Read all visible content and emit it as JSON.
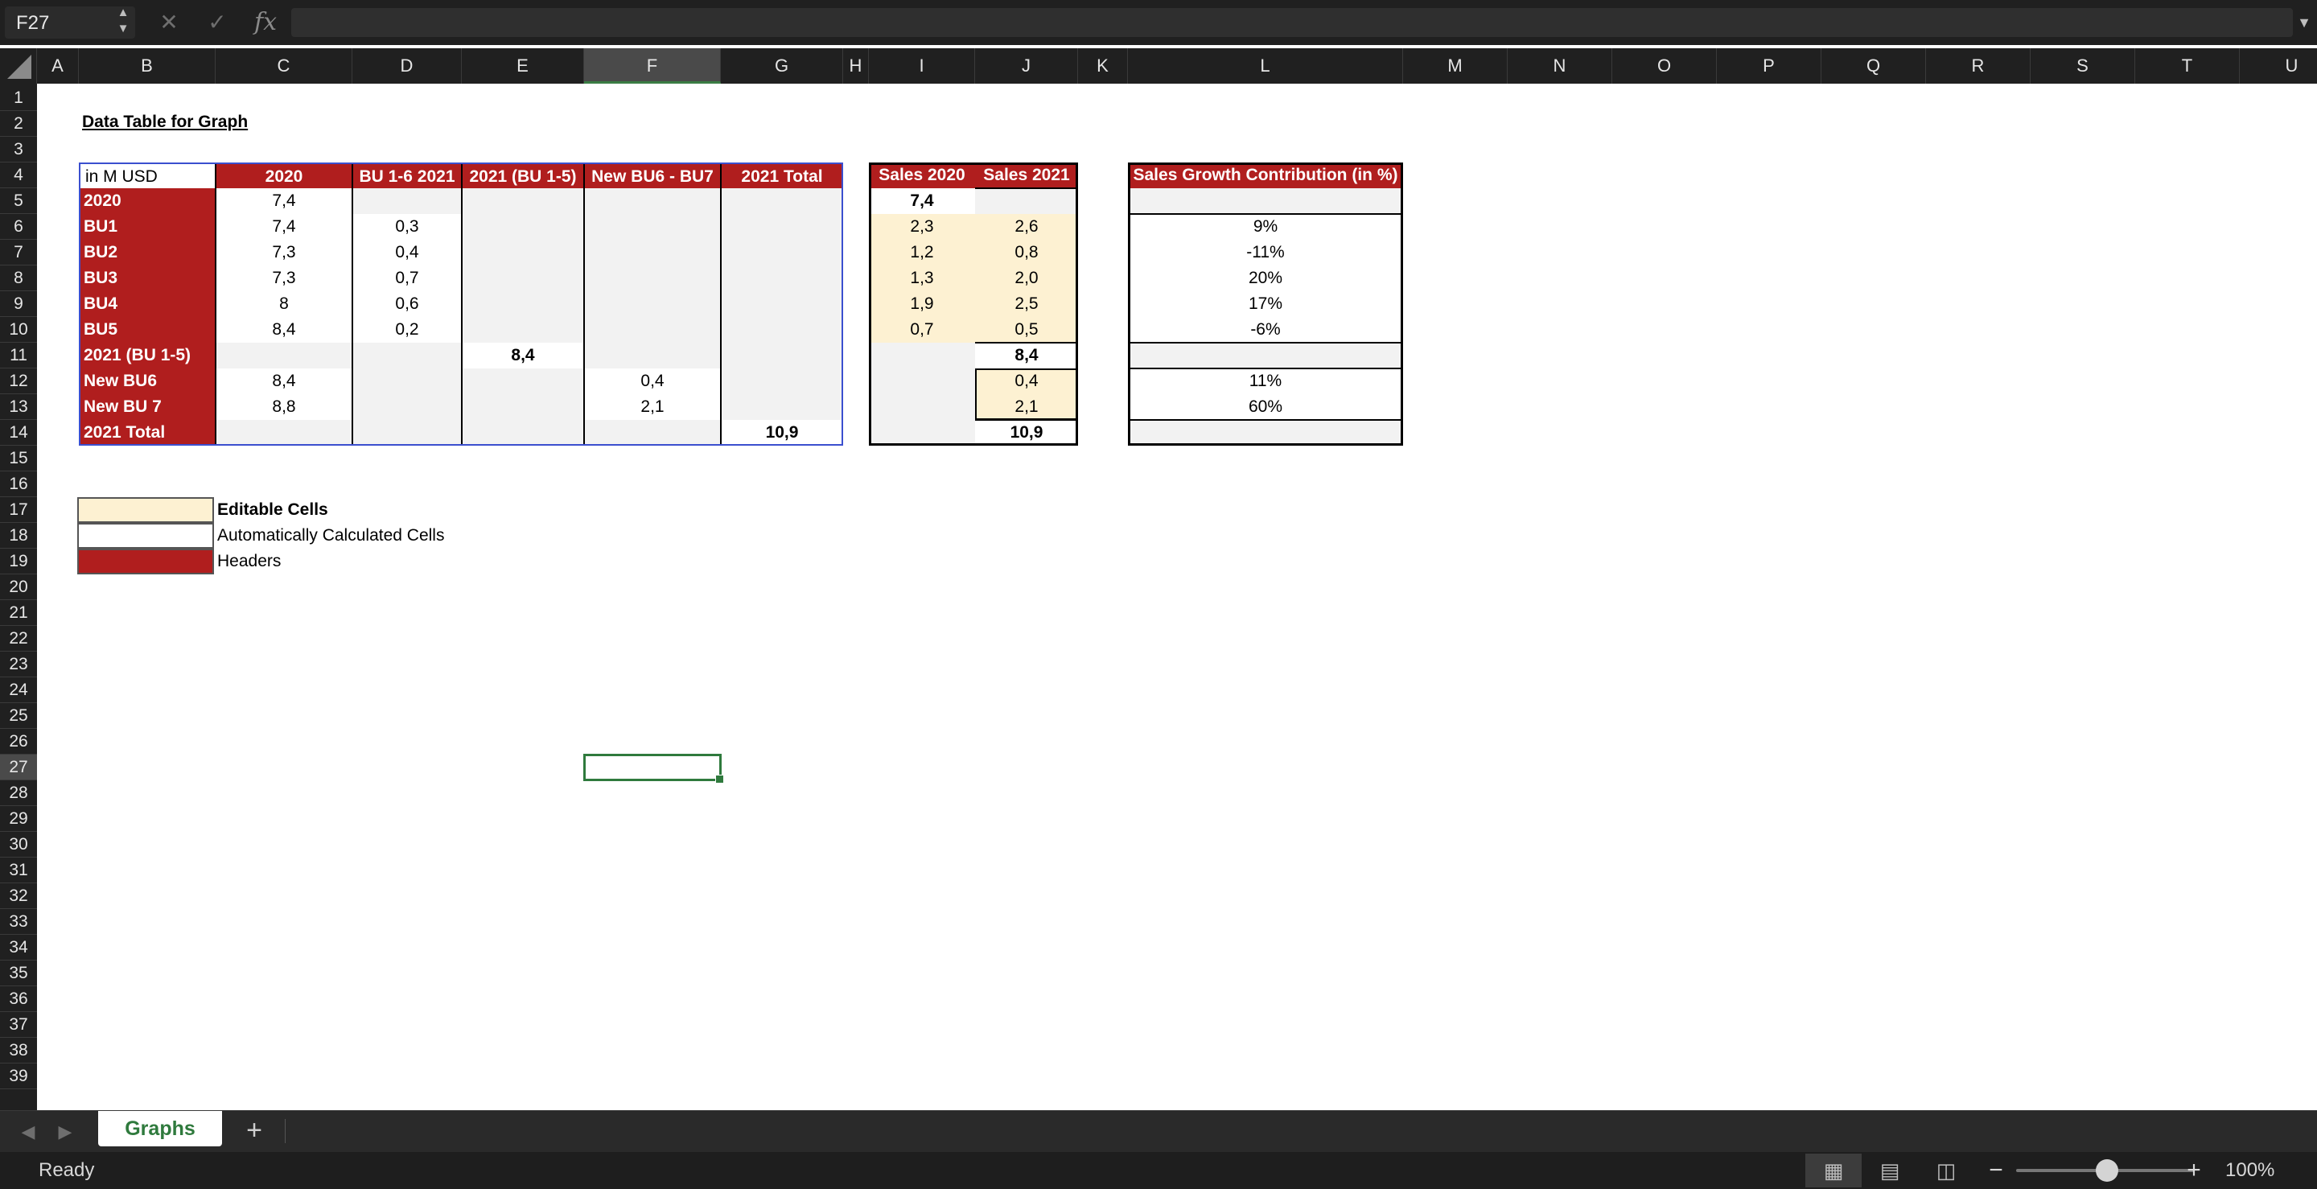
{
  "formula_bar": {
    "name_box": "F27",
    "cancel_icon": "x-icon",
    "enter_icon": "check-icon",
    "fx_label": "fx",
    "formula_value": ""
  },
  "columns": [
    "A",
    "B",
    "C",
    "D",
    "E",
    "F",
    "G",
    "H",
    "I",
    "J",
    "K",
    "L",
    "M",
    "N",
    "O",
    "P",
    "Q",
    "R",
    "S",
    "T",
    "U"
  ],
  "selected_column": "F",
  "rows": [
    "1",
    "2",
    "3",
    "4",
    "5",
    "6",
    "7",
    "8",
    "9",
    "10",
    "11",
    "12",
    "13",
    "14",
    "15",
    "16",
    "17",
    "18",
    "19",
    "20",
    "21",
    "22",
    "23",
    "24",
    "25",
    "26",
    "27",
    "28",
    "29",
    "30",
    "31",
    "32",
    "33",
    "34",
    "35",
    "36",
    "37",
    "38",
    "39"
  ],
  "selected_row": "27",
  "sheet": {
    "title": "Data Table for Graph",
    "table1": {
      "corner": "in M USD",
      "headers": [
        "2020",
        "BU 1-6 2021",
        "2021 (BU 1-5)",
        "New BU6 - BU7",
        "2021 Total"
      ],
      "rows": [
        {
          "label": "2020",
          "values": [
            "7,4",
            "",
            "",
            "",
            ""
          ]
        },
        {
          "label": "BU1",
          "values": [
            "7,4",
            "0,3",
            "",
            "",
            ""
          ]
        },
        {
          "label": "BU2",
          "values": [
            "7,3",
            "0,4",
            "",
            "",
            ""
          ]
        },
        {
          "label": "BU3",
          "values": [
            "7,3",
            "0,7",
            "",
            "",
            ""
          ]
        },
        {
          "label": "BU4",
          "values": [
            "8",
            "0,6",
            "",
            "",
            ""
          ]
        },
        {
          "label": "BU5",
          "values": [
            "8,4",
            "0,2",
            "",
            "",
            ""
          ]
        },
        {
          "label": "2021 (BU 1-5)",
          "values": [
            "",
            "",
            "8,4",
            "",
            ""
          ]
        },
        {
          "label": "New BU6",
          "values": [
            "8,4",
            "",
            "",
            "0,4",
            ""
          ]
        },
        {
          "label": "New BU 7",
          "values": [
            "8,8",
            "",
            "",
            "2,1",
            ""
          ]
        },
        {
          "label": "2021 Total",
          "values": [
            "",
            "",
            "",
            "",
            "10,9"
          ]
        }
      ]
    },
    "table2": {
      "headers": [
        "Sales 2020",
        "Sales 2021"
      ],
      "rows": [
        [
          "7,4",
          ""
        ],
        [
          "2,3",
          "2,6"
        ],
        [
          "1,2",
          "0,8"
        ],
        [
          "1,3",
          "2,0"
        ],
        [
          "1,9",
          "2,5"
        ],
        [
          "0,7",
          "0,5"
        ],
        [
          "",
          "8,4"
        ],
        [
          "",
          "0,4"
        ],
        [
          "",
          "2,1"
        ],
        [
          "",
          "10,9"
        ]
      ]
    },
    "table3": {
      "header": "Sales Growth Contribution (in %)",
      "rows": [
        "",
        "9%",
        "-11%",
        "20%",
        "17%",
        "-6%",
        "",
        "11%",
        "60%",
        ""
      ]
    },
    "legend": [
      {
        "label": "Editable Cells",
        "color": "#fdf1d2"
      },
      {
        "label": "Automatically Calculated Cells",
        "color": "#ffffff"
      },
      {
        "label": "Headers",
        "color": "#b01e1e"
      }
    ]
  },
  "tabs": {
    "items": [
      {
        "label": "Graphs",
        "active": true
      }
    ],
    "add_icon": "plus-icon"
  },
  "status": {
    "text": "Ready",
    "zoom": "100%",
    "zoom_fraction": 0.5
  },
  "colors": {
    "header_red": "#b01e1e",
    "editable": "#fdf1d2",
    "calc_grey": "#f2f2f2",
    "accent_green": "#2f7a3d"
  }
}
